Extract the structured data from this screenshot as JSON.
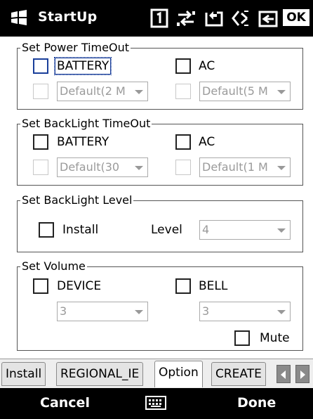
{
  "status_bar": {
    "app_title": "StartUp",
    "icons": [
      "windows-start-icon",
      "sim-icon",
      "connectivity-icon",
      "battery-icon",
      "volume-mute-icon",
      "close-icon",
      "ok-icon"
    ],
    "ok_label": "OK"
  },
  "power_timeout": {
    "legend": "Set Power TimeOut",
    "battery_label": "BATTERY",
    "ac_label": "AC",
    "battery_value": "Default(2 M",
    "ac_value": "Default(5 M"
  },
  "backlight_timeout": {
    "legend": "Set BackLight TimeOut",
    "battery_label": "BATTERY",
    "ac_label": "AC",
    "battery_value": "Default(30",
    "ac_value": "Default(1 M"
  },
  "backlight_level": {
    "legend": "Set BackLight Level",
    "install_label": "Install",
    "level_label": "Level",
    "level_value": "4"
  },
  "volume": {
    "legend": "Set Volume",
    "device_label": "DEVICE",
    "bell_label": "BELL",
    "device_value": "3",
    "bell_value": "3",
    "mute_label": "Mute"
  },
  "tabs": {
    "items": [
      "Install",
      "REGIONAL_IE",
      "Option",
      "CREATE"
    ],
    "active": "Option"
  },
  "softkeys": {
    "left": "Cancel",
    "right": "Done"
  },
  "colors": {
    "bar_background": "#000000",
    "focus_blue": "#1a3f9a",
    "disabled_text": "#9a9a9a"
  }
}
